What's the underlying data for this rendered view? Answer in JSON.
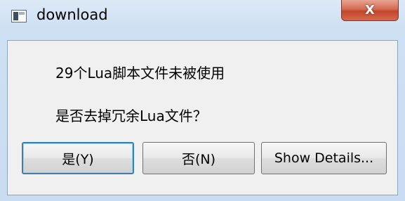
{
  "window": {
    "title": "download",
    "close_label": "X"
  },
  "message": {
    "line1": "29个Lua脚本文件未被使用",
    "line2": "是否去掉冗余Lua文件？"
  },
  "buttons": {
    "yes_label": "是(Y)",
    "no_label": "否(N)",
    "details_label": "Show Details..."
  }
}
